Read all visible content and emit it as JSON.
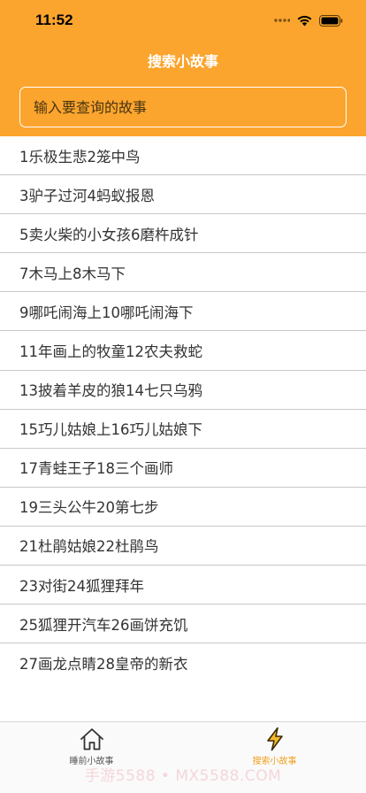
{
  "status_bar": {
    "time": "11:52"
  },
  "nav": {
    "title": "搜索小故事"
  },
  "search": {
    "placeholder": "输入要查询的故事"
  },
  "stories": [
    "1乐极生悲2笼中鸟",
    "3驴子过河4蚂蚁报恩",
    "5卖火柴的小女孩6磨杵成针",
    "7木马上8木马下",
    "9哪吒闹海上10哪吒闹海下",
    "11年画上的牧童12农夫救蛇",
    "13披着羊皮的狼14七只乌鸦",
    "15巧儿姑娘上16巧儿姑娘下",
    "17青蛙王子18三个画师",
    "19三头公牛20第七步",
    "21杜鹃姑娘22杜鹃鸟",
    "23对街24狐狸拜年",
    "25狐狸开汽车26画饼充饥",
    "27画龙点睛28皇帝的新衣"
  ],
  "tab_bar": {
    "home": {
      "label": "睡前小故事",
      "icon": "home-icon"
    },
    "search": {
      "label": "搜索小故事",
      "icon": "lightning-icon",
      "active_color": "#f0a01e"
    }
  },
  "watermark": "手游5588 • MX5588.COM",
  "colors": {
    "header": "#fba52e",
    "accent": "#f0a01e"
  }
}
